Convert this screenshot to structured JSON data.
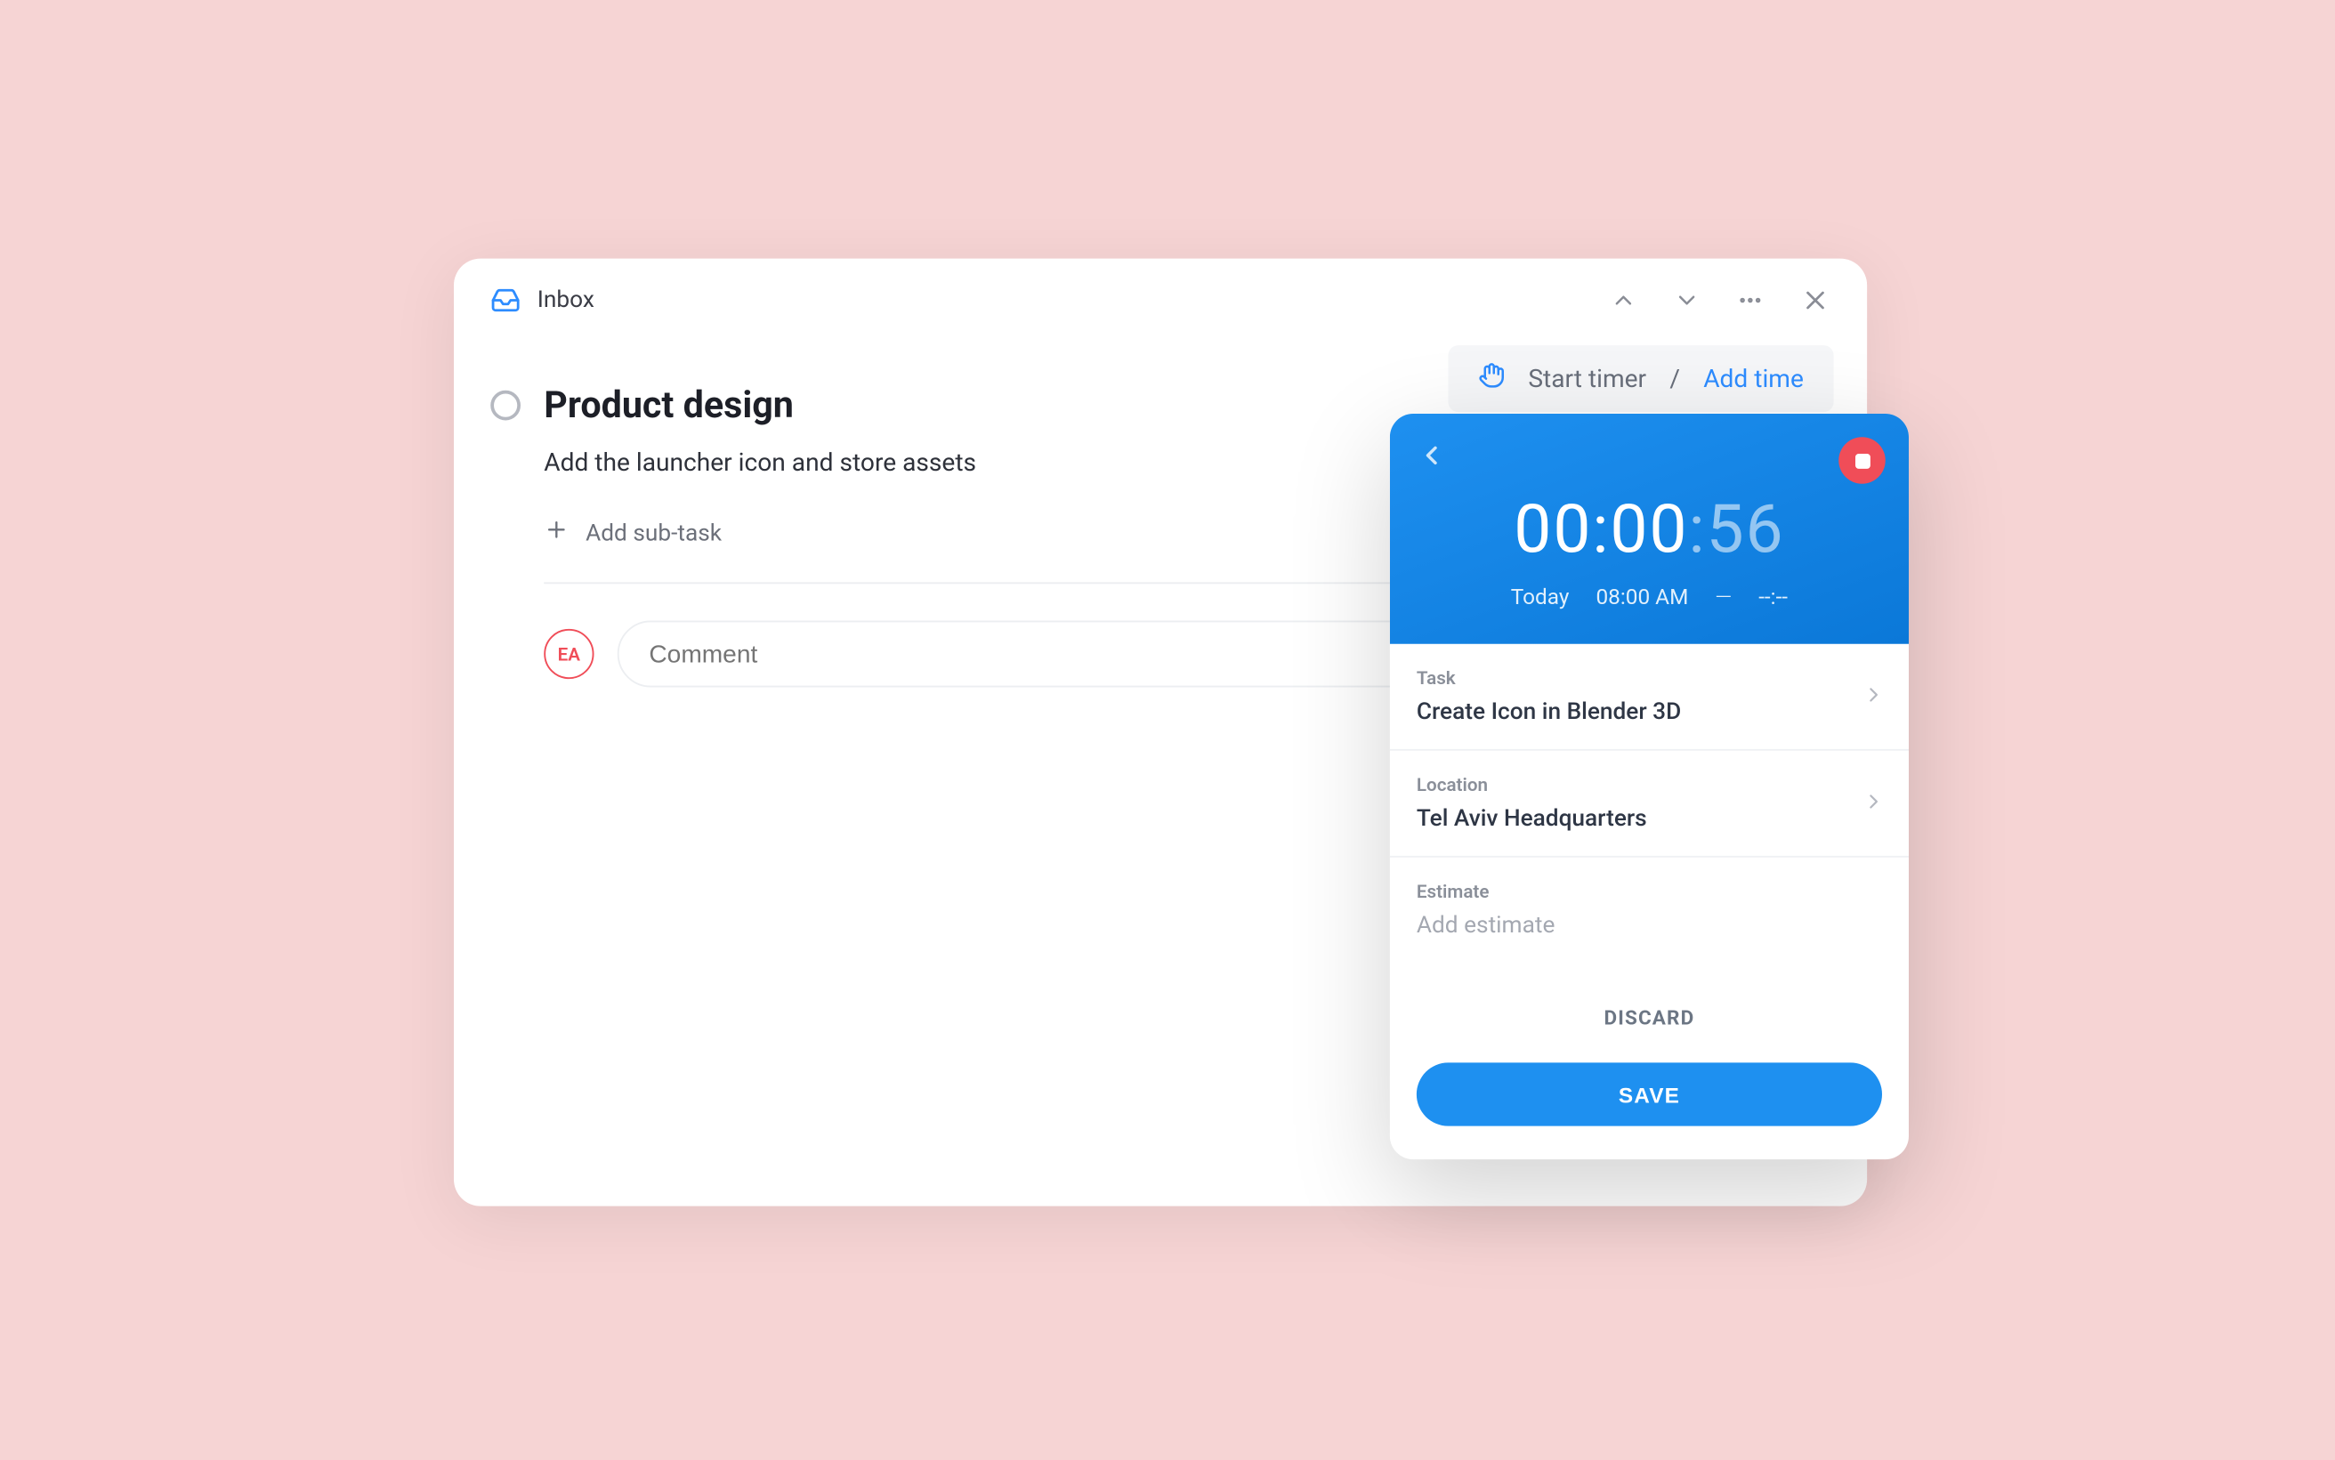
{
  "header": {
    "inbox_label": "Inbox"
  },
  "timer_bar": {
    "start_label": "Start timer",
    "separator": "/",
    "add_time_label": "Add time"
  },
  "task": {
    "title": "Product design",
    "description": "Add the launcher icon and store assets",
    "add_subtask_label": "Add sub-task"
  },
  "comment": {
    "avatar_initials": "EA",
    "placeholder": "Comment"
  },
  "timer_panel": {
    "time_main": "00:00",
    "time_seconds": ":56",
    "day_label": "Today",
    "start_time": "08:00 AM",
    "minus": "—",
    "end_time": "--:--",
    "fields": {
      "task": {
        "label": "Task",
        "value": "Create Icon in Blender 3D"
      },
      "location": {
        "label": "Location",
        "value": "Tel Aviv Headquarters"
      },
      "estimate": {
        "label": "Estimate",
        "placeholder": "Add estimate"
      }
    },
    "discard_label": "DISCARD",
    "save_label": "SAVE"
  }
}
